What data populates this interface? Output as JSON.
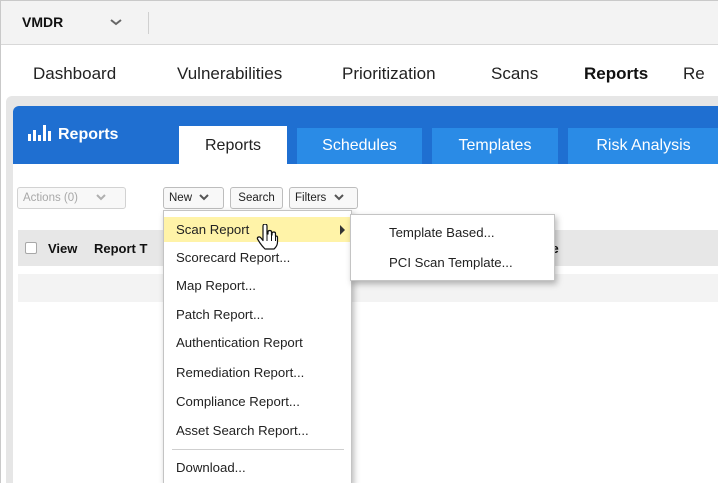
{
  "app_switcher": {
    "name": "VMDR"
  },
  "main_nav": [
    "Dashboard",
    "Vulnerabilities",
    "Prioritization",
    "Scans",
    "Reports",
    "Re"
  ],
  "active_nav": "Reports",
  "module_title": "Reports",
  "tabs": [
    "Reports",
    "Schedules",
    "Templates",
    "Risk Analysis"
  ],
  "active_tab": "Reports",
  "toolbar": {
    "actions_label": "Actions (0)",
    "new_label": "New",
    "search_label": "Search",
    "filters_label": "Filters"
  },
  "table": {
    "columns": [
      "View",
      "Report T",
      "ate"
    ]
  },
  "new_menu": {
    "items": [
      "Scan Report",
      "Scorecard Report...",
      "Map Report...",
      "Patch Report...",
      "Authentication Report",
      "Remediation Report...",
      "Compliance Report...",
      "Asset Search Report...",
      "Download..."
    ],
    "highlighted": "Scan Report",
    "highlight_color": "#fff3a8"
  },
  "scan_report_submenu": {
    "items": [
      "Template Based...",
      "PCI Scan Template..."
    ]
  },
  "colors": {
    "tabbar": "#1f6fd1",
    "tab": "#2a8be6",
    "header_bg": "#e7e7e7"
  }
}
